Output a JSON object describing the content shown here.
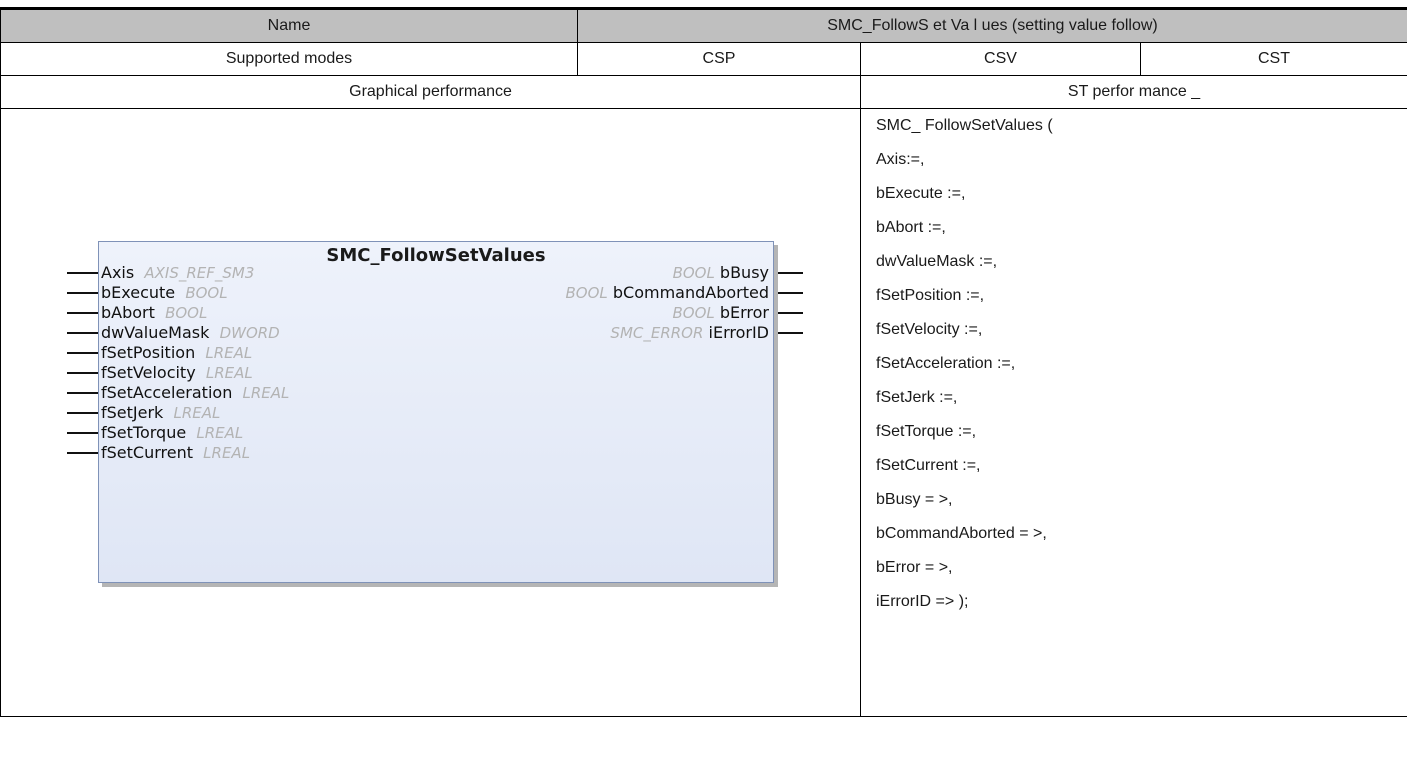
{
  "header": {
    "name_label": "Name",
    "name_value": "SMC_FollowS et Va l ues (setting value follow)"
  },
  "modes": {
    "label": "Supported modes",
    "items": [
      "CSP",
      "CSV",
      "CST"
    ]
  },
  "performance": {
    "graphical_label": "Graphical performance",
    "st_label": "ST perfor mance _"
  },
  "fb": {
    "title": "SMC_FollowSetValues",
    "inputs": [
      {
        "name": "Axis",
        "type": "AXIS_REF_SM3"
      },
      {
        "name": "bExecute",
        "type": "BOOL"
      },
      {
        "name": "bAbort",
        "type": "BOOL"
      },
      {
        "name": "dwValueMask",
        "type": "DWORD"
      },
      {
        "name": "fSetPosition",
        "type": "LREAL"
      },
      {
        "name": "fSetVelocity",
        "type": "LREAL"
      },
      {
        "name": "fSetAcceleration",
        "type": "LREAL"
      },
      {
        "name": "fSetJerk",
        "type": "LREAL"
      },
      {
        "name": "fSetTorque",
        "type": "LREAL"
      },
      {
        "name": "fSetCurrent",
        "type": "LREAL"
      }
    ],
    "outputs": [
      {
        "name": "bBusy",
        "type": "BOOL"
      },
      {
        "name": "bCommandAborted",
        "type": "BOOL"
      },
      {
        "name": "bError",
        "type": "BOOL"
      },
      {
        "name": "iErrorID",
        "type": "SMC_ERROR"
      }
    ]
  },
  "st_code": [
    "SMC_ FollowSetValues (",
    "Axis:=,",
    "bExecute :=,",
    "bAbort :=,",
    "dwValueMask :=,",
    "fSetPosition :=,",
    "fSetVelocity :=,",
    "fSetAcceleration :=,",
    "fSetJerk :=,",
    "fSetTorque :=,",
    "fSetCurrent :=,",
    "bBusy = >,",
    "bCommandAborted = >,",
    "bError = >,",
    "iErrorID => );"
  ]
}
